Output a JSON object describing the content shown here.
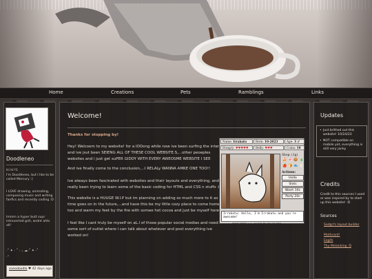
{
  "nav": {
    "items": [
      "Home",
      "Creations",
      "Pets",
      "Ramblings",
      "Links"
    ]
  },
  "sidebar": {
    "name": "Doodleneo",
    "bio": [
      "Hi hi!!1",
      "I'm Doodleneo, but I like to be called Mercury :]",
      "I LOVE drawing, animating, composing music and writing fanfics and recently coding :D",
      "Immm a hyper butt supr introverted grill, andnt ahts all!"
    ],
    "sparkle_text": "·˚ ✦ · ˚ · ₊ ☁·˚ ✦ ·˚",
    "sparkle_text2": "‧˚ ",
    "card": {
      "user": "sneodoodle",
      "heart": "♥",
      "time": "42 days ago"
    }
  },
  "main": {
    "title": "Welcome!",
    "thanks": "Thanks for stopping by!",
    "paragraphs": [
      "Hey! Welcoem to my website! for a lOOong while now ive been surfing the internet and ive jsut been SEIENG ALL OF THESE COOL WEBSITE.S,...other peoeples websites and i just get suPER GIDDY WITH EVERY AWEOSME WEBSITE I SEE",
      "And ive finally come to the conclusion,...I RELALy WANNA AMKE ONE TOO!!",
      "Ive always been fascinated with websites and their layouts and everything, and i really been trying to learn some of the basic coding for HTML and CSS n stuffs :D",
      "This website is a HUUGE W.I.P but im planning on adding so much more to it as time goes on in the future,...and have this be my little cozy place to come home too and warm my feet by the fire with somee hot cocoa and just be myself here :]",
      "I feel like I cant truly be myself on aL.l of those popular social medias and need some sort of outlet where i can talk about whatever and post everything ive worked on!"
    ]
  },
  "pet": {
    "name_label": "Name: ",
    "name": "Irrakatu",
    "born_label": "Born: ",
    "born": "10-2023",
    "age_label": "Age: ",
    "age": "3",
    "gender": "♂",
    "hungry_label": "Hungry: ",
    "hungry": "♥♥♥♥♥",
    "belly_label": "Belly: ",
    "belly": "♥♥♥",
    "coins_label": "Coins: ",
    "coins": "10",
    "shop_label": "Shop: (1g)",
    "actions_label": "Actions:",
    "buttons": [
      "Hello",
      "Slots",
      "Wash 10c",
      "Party 20c"
    ],
    "speech": "Irrakatu: Hello, I'm Irrakatu and you're awesome!",
    "credit": "PIXELPETS 2.0 · MADE BY SB OF PET"
  },
  "right": {
    "updates_title": "Updates",
    "updates": [
      "Just brithed out this website! 10/24/23",
      "NOT compatible on mobile yet, everything is still very janky"
    ],
    "credits_title": "Credits",
    "credits_text": "Credit to this sources I used or was inspired by to start up this website! :D",
    "sources_title": "Sources",
    "sources": [
      "Sadgrl's layout builder",
      "Mothcard!",
      "Ezgifs",
      "Thy Melanking :D"
    ]
  },
  "colors": {
    "accent": "#d9a88a",
    "link": "#e2b090",
    "panel": "#221e1d"
  }
}
